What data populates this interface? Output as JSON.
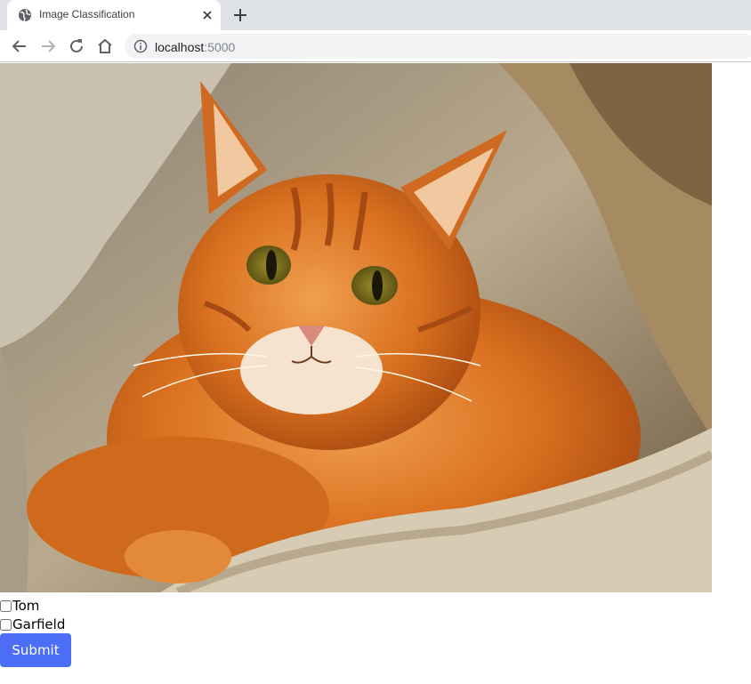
{
  "browser": {
    "tab_title": "Image Classification",
    "url_host": "localhost",
    "url_port": ":5000"
  },
  "icons": {
    "favicon": "globe-icon",
    "tab_close": "close-icon",
    "new_tab": "plus-icon",
    "back": "arrow-left-icon",
    "forward": "arrow-right-icon",
    "reload": "reload-icon",
    "home": "home-icon",
    "site_info": "info-icon"
  },
  "form": {
    "image": "photo of an orange tabby cat lying on a beige fleece blanket",
    "options": [
      {
        "label": "Tom",
        "checked": false
      },
      {
        "label": "Garfield",
        "checked": false
      }
    ],
    "submit_label": "Submit"
  },
  "colors": {
    "submit_bg": "#4c6ef5",
    "tabstrip_bg": "#dee1e6"
  }
}
